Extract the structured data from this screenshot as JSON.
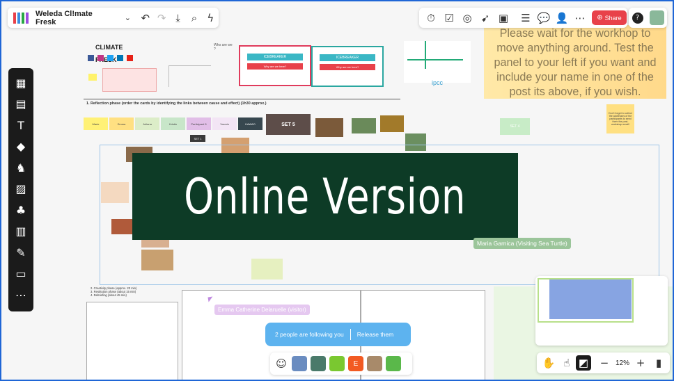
{
  "board": {
    "title": "Weleda Cl!mate Fresk",
    "share_label": "Share",
    "zoom": "12%",
    "follow_text": "2 people are following you",
    "release_label": "Release them",
    "overlay_text": "Online Version",
    "wait_note": "Please wait for the workhop to move anything around. Test the panel to your left if you want and include your name in one of the post its above, if you wish.",
    "cursor_user": "Maria Garnica (Visiting Sea Turtle)",
    "cursor_user2": "Emma Catherine Delaruelle (visitor)",
    "reflection_title": "1. Reflection phase (order the cards by identifying the links between cause and effect) (1h30 approx.)",
    "icebreaker1": "ICEBREAKER",
    "icebreaker2": "ICEBREAKER",
    "why_here": "Why are we here?",
    "who_are_we": "Who are we ?",
    "set5": "SET 5",
    "set1": "SET 1",
    "set4": "SET 4",
    "phases": [
      "2. Creativity phase (approx. 20 min)",
      "3. Restitution phase (about 15 min)",
      "4. Debriefing (about 45 min)"
    ],
    "participants": [
      "Marie",
      "Emma",
      "Juliana",
      "Kristin",
      "Participant 5",
      "Yasmin",
      "KAWAO"
    ],
    "reminder": "Don't forget to collect the addresses of the participants to send them the post-workshop email!",
    "climate_fresk": "CLIMATE FRESK",
    "ipcc": "ipcc",
    "colors": {
      "accent": "#e8414a",
      "frame": "#1f66d6",
      "overlay": "#0d3b26"
    }
  }
}
